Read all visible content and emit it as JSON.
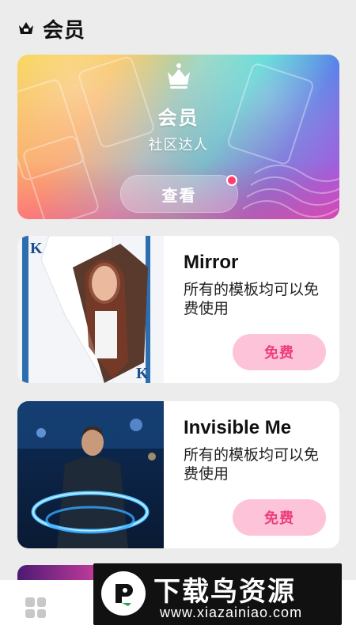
{
  "header": {
    "title": "会员",
    "icon": "crown-icon"
  },
  "hero": {
    "title": "会员",
    "subtitle": "社区达人",
    "button_label": "查看",
    "icon": "crown-icon",
    "has_notification": true,
    "colors": {
      "notification": "#ff3b70"
    }
  },
  "templates": [
    {
      "title": "Mirror",
      "description": "所有的模板均可以免费使用",
      "button_label": "免费"
    },
    {
      "title": "Invisible Me",
      "description": "所有的模板均可以免费使用",
      "button_label": "免费"
    }
  ],
  "tabbar": {
    "icon": "grid-icon"
  },
  "watermark": {
    "title": "下载鸟资源",
    "url": "www.xiazainiao.com"
  },
  "colors": {
    "accent": "#ef3d7a",
    "free_button_bg": "#fcc3d9"
  }
}
